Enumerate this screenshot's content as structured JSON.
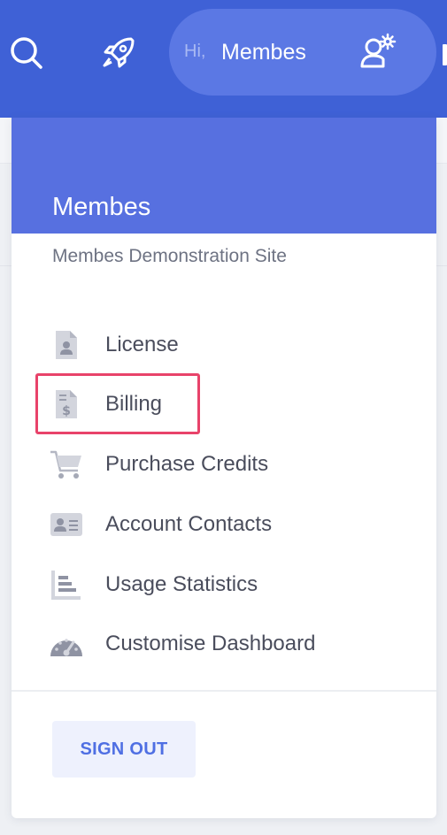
{
  "topbar": {
    "search_icon": "search-icon",
    "rocket_icon": "rocket-icon",
    "greeting": "Hi,",
    "user_name": "Membes",
    "user_settings_icon": "user-settings-icon",
    "brand_color": "#3f61d6"
  },
  "dropdown": {
    "title": "Membes",
    "subtitle": "Membes Demonstration Site",
    "header_color": "#5770e0",
    "items": [
      {
        "label": "License",
        "icon": "license-document-icon"
      },
      {
        "label": "Billing",
        "icon": "billing-invoice-icon",
        "highlighted": true
      },
      {
        "label": "Purchase Credits",
        "icon": "shopping-cart-icon"
      },
      {
        "label": "Account Contacts",
        "icon": "contact-card-icon"
      },
      {
        "label": "Usage Statistics",
        "icon": "bar-chart-icon"
      },
      {
        "label": "Customise Dashboard",
        "icon": "dashboard-gauge-icon"
      }
    ],
    "highlight_color": "#e8436a",
    "sign_out_label": "SIGN OUT"
  }
}
